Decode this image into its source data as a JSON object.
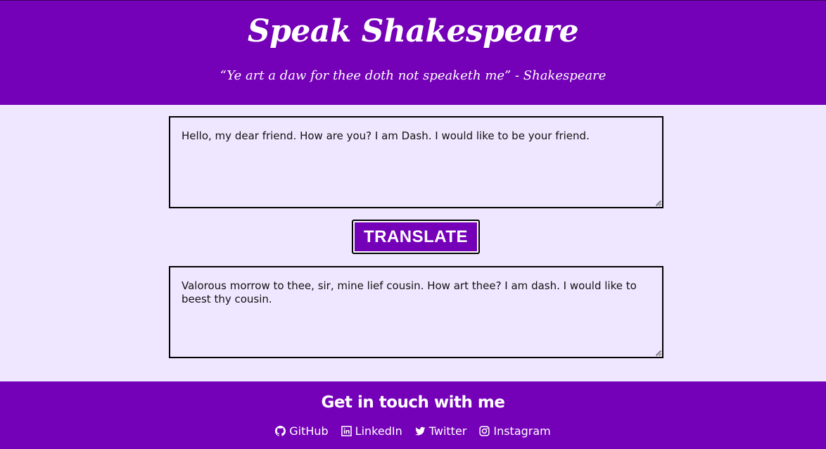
{
  "header": {
    "title": "Speak Shakespeare",
    "tagline": "“Ye art a daw for thee doth not speaketh me” - Shakespeare"
  },
  "translator": {
    "input_value": "Hello, my dear friend. How are you? I am Dash. I would like to be your friend.",
    "button_label": "TRANSLATE",
    "output_value": "Valorous morrow to thee,  sir,  mine lief cousin. How art thee? I am dash. I would like to beest thy cousin."
  },
  "footer": {
    "title": "Get in touch with me",
    "links": [
      {
        "label": "GitHub",
        "icon": "github-icon"
      },
      {
        "label": "LinkedIn",
        "icon": "linkedin-icon"
      },
      {
        "label": "Twitter",
        "icon": "twitter-icon"
      },
      {
        "label": "Instagram",
        "icon": "instagram-icon"
      }
    ]
  },
  "colors": {
    "primary": "#7400b8",
    "background": "#efe7ff",
    "text": "#ffffff"
  }
}
